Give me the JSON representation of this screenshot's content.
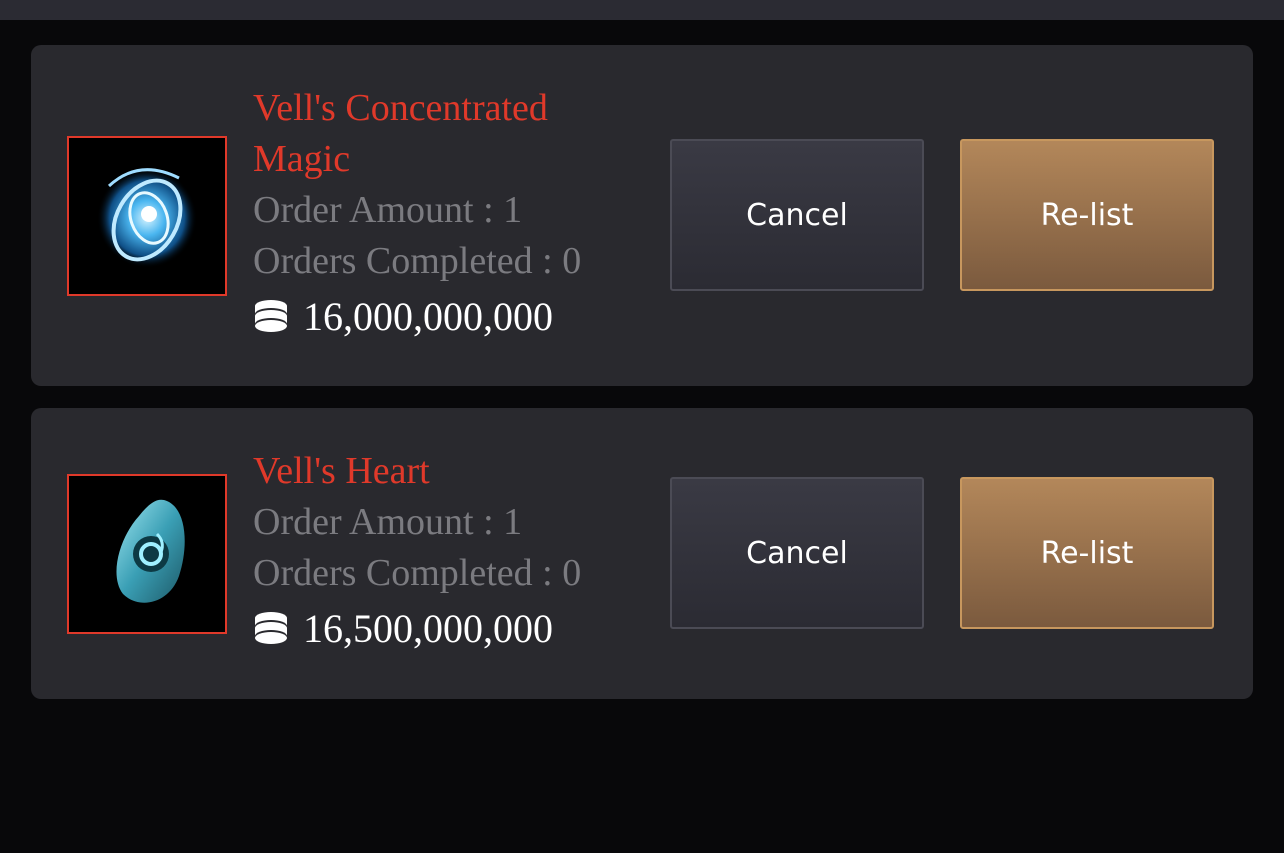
{
  "orders": [
    {
      "name": "Vell's Concentrated Magic",
      "order_amount": "Order Amount : 1",
      "orders_completed": "Orders Completed : 0",
      "price": "16,000,000,000",
      "icon": "concentrated-magic-orb-icon",
      "cancel_label": "Cancel",
      "relist_label": "Re-list"
    },
    {
      "name": "Vell's Heart",
      "order_amount": "Order Amount : 1",
      "orders_completed": "Orders Completed : 0",
      "price": "16,500,000,000",
      "icon": "vells-heart-gem-icon",
      "cancel_label": "Cancel",
      "relist_label": "Re-list"
    }
  ],
  "colors": {
    "item_name": "#e0392a",
    "stat_text": "#7b7b80",
    "card_bg": "#29292e",
    "relist_top": "#b3875a",
    "relist_bottom": "#7b5a3e",
    "cancel_bg": "#34343d"
  },
  "currency_icon": "silver-coin-stack-icon"
}
